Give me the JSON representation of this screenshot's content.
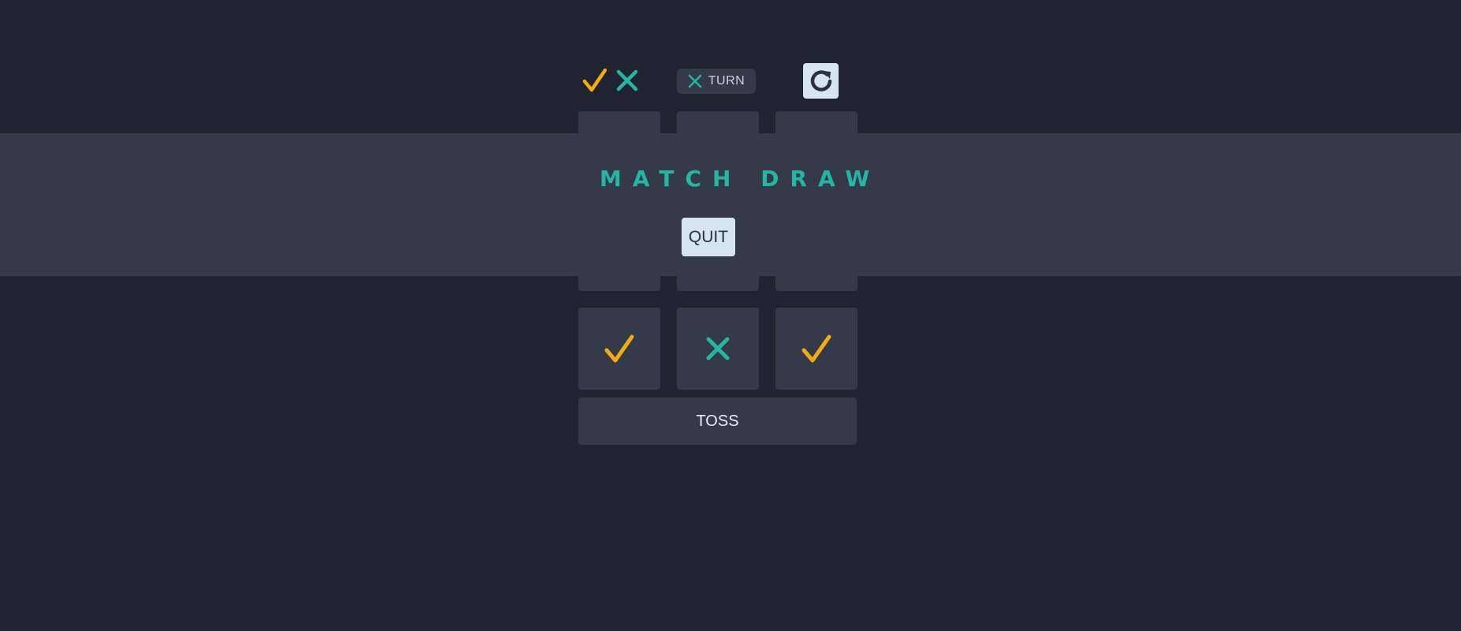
{
  "header": {
    "logo_icons": [
      "check-icon",
      "x-icon"
    ],
    "turn": {
      "icon": "x-icon",
      "label": "TURN"
    },
    "restart_icon": "restart-icon"
  },
  "board": {
    "cells": [
      "",
      "",
      "",
      "",
      "",
      "",
      "check",
      "x",
      "check"
    ]
  },
  "toss_label": "TOSS",
  "result": {
    "title": "MATCH DRAW",
    "quit_label": "QUIT"
  },
  "colors": {
    "background": "#1f2430",
    "surface": "#343a4a",
    "check": "#f2ac0e",
    "x": "#25b5a3",
    "light_button": "#d6e6ee"
  }
}
